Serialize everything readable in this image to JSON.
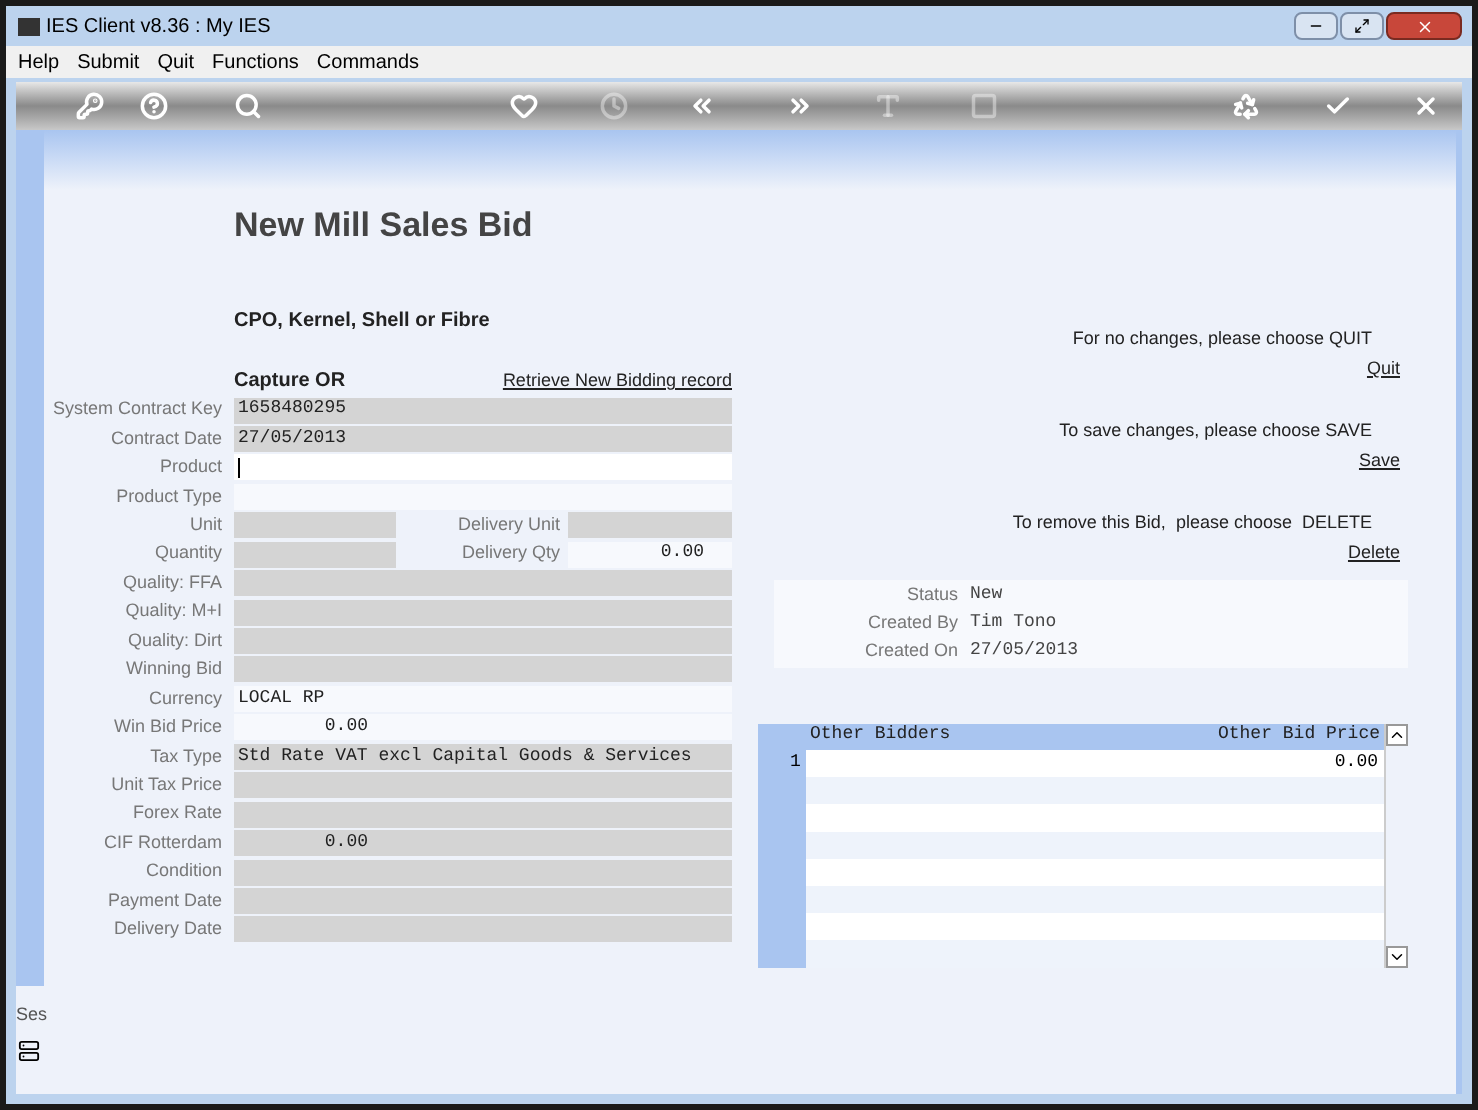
{
  "window": {
    "title": "IES Client v8.36 : My IES"
  },
  "menu": [
    "Help",
    "Submit",
    "Quit",
    "Functions",
    "Commands"
  ],
  "toolbar": [
    {
      "kind": "key",
      "disabled": false
    },
    {
      "kind": "help",
      "disabled": false
    },
    {
      "kind": "search",
      "disabled": false
    },
    {
      "kind": "heart",
      "disabled": false
    },
    {
      "kind": "clock",
      "disabled": true
    },
    {
      "kind": "back",
      "disabled": false
    },
    {
      "kind": "forward",
      "disabled": false
    },
    {
      "kind": "text",
      "disabled": true
    },
    {
      "kind": "stop",
      "disabled": true
    },
    {
      "kind": "recycle",
      "disabled": false
    },
    {
      "kind": "check",
      "disabled": false
    },
    {
      "kind": "close",
      "disabled": false
    }
  ],
  "form": {
    "title": "New Mill Sales Bid",
    "subtitle": "CPO, Kernel, Shell or Fibre",
    "capture_label": "Capture OR",
    "retrieve_link": "Retrieve New Bidding record",
    "fields": [
      {
        "kind": "text",
        "label": "System Contract Key",
        "value": "1658480295",
        "disabled": true
      },
      {
        "kind": "text",
        "label": "Contract Date",
        "value": "27/05/2013",
        "disabled": true
      },
      {
        "kind": "text",
        "label": "Product",
        "disabled": false,
        "focused": true
      },
      {
        "kind": "text",
        "label": "Product Type",
        "disabled": false
      },
      {
        "kind": "pair",
        "label": "Unit",
        "disabled": true,
        "second": {
          "label": "Delivery Unit",
          "disabled": true
        }
      },
      {
        "kind": "pair",
        "label": "Quantity",
        "disabled": true,
        "second": {
          "label": "Delivery Qty",
          "value": "0.00",
          "disabled": false
        }
      },
      {
        "kind": "text",
        "label": "Quality: FFA",
        "disabled": true
      },
      {
        "kind": "text",
        "label": "Quality: M+I",
        "disabled": true
      },
      {
        "kind": "text",
        "label": "Quality: Dirt",
        "disabled": true
      },
      {
        "kind": "text",
        "label": "Winning Bid",
        "disabled": true
      },
      {
        "kind": "text",
        "label": "Currency",
        "value": "LOCAL RP",
        "disabled": false
      },
      {
        "kind": "amount",
        "label": "Win Bid Price",
        "value": "0.00",
        "disabled": false
      },
      {
        "kind": "text",
        "label": "Tax Type",
        "value": "Std Rate VAT excl Capital Goods & Services",
        "disabled": true
      },
      {
        "kind": "text",
        "label": "Unit Tax Price",
        "disabled": true
      },
      {
        "kind": "text",
        "label": "Forex Rate",
        "disabled": true
      },
      {
        "kind": "amount",
        "label": "CIF Rotterdam",
        "value": "0.00",
        "disabled": true
      },
      {
        "kind": "text",
        "label": "Condition",
        "disabled": true
      },
      {
        "kind": "text",
        "label": "Payment Date",
        "disabled": true
      },
      {
        "kind": "text",
        "label": "Delivery Date",
        "disabled": true
      }
    ]
  },
  "actions": [
    {
      "message": "For no changes, please choose QUIT",
      "link": "Quit"
    },
    {
      "message": "To save changes, please choose SAVE",
      "link": "Save"
    },
    {
      "message": "To remove this Bid,  please choose  DELETE",
      "link": "Delete"
    }
  ],
  "status_panel": [
    {
      "label": "Status",
      "value": "New"
    },
    {
      "label": "Created By",
      "value": "Tim Tono"
    },
    {
      "label": "Created On",
      "value": "27/05/2013"
    }
  ],
  "grid": {
    "columns": [
      "Other Bidders",
      "Other Bid Price"
    ],
    "rows": [
      {
        "number": "1",
        "price": "0.00"
      }
    ]
  },
  "sidebar": {
    "label": "Ses"
  }
}
